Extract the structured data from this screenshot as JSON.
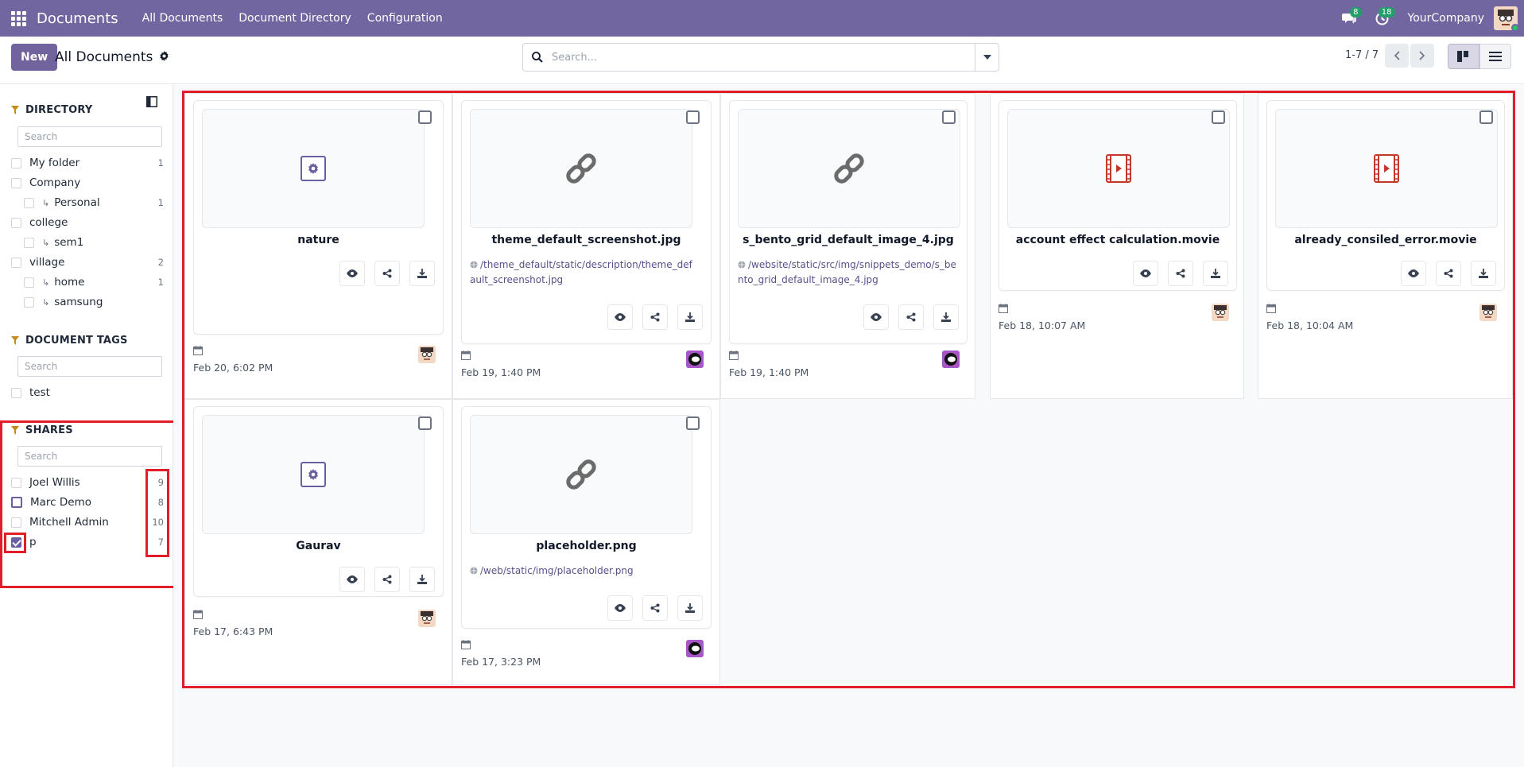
{
  "navbar": {
    "brand": "Documents",
    "menu": [
      "All Documents",
      "Document Directory",
      "Configuration"
    ],
    "messages_count": "8",
    "activities_count": "18",
    "company": "YourCompany"
  },
  "control": {
    "new_label": "New",
    "breadcrumb": "All Documents",
    "search_placeholder": "Search...",
    "pager": "1-7 / 7"
  },
  "sidebar": {
    "directory": {
      "title": "DIRECTORY",
      "search_placeholder": "Search",
      "items": [
        {
          "label": "My folder",
          "count": "1",
          "indent": false
        },
        {
          "label": "Company",
          "count": "",
          "indent": false
        },
        {
          "label": "Personal",
          "count": "1",
          "indent": true
        },
        {
          "label": "college",
          "count": "",
          "indent": false
        },
        {
          "label": "sem1",
          "count": "",
          "indent": true
        },
        {
          "label": "village",
          "count": "2",
          "indent": false
        },
        {
          "label": "home",
          "count": "1",
          "indent": true
        },
        {
          "label": "samsung",
          "count": "",
          "indent": true
        }
      ]
    },
    "tags": {
      "title": "DOCUMENT TAGS",
      "search_placeholder": "Search",
      "items": [
        {
          "label": "test",
          "count": ""
        }
      ]
    },
    "shares": {
      "title": "SHARES",
      "search_placeholder": "Search",
      "items": [
        {
          "label": "Joel Willis",
          "count": "9",
          "checked": false
        },
        {
          "label": "Marc Demo",
          "count": "8",
          "checked": false
        },
        {
          "label": "Mitchell Admin",
          "count": "10",
          "checked": false
        },
        {
          "label": "p",
          "count": "7",
          "checked": true
        }
      ]
    }
  },
  "cards": [
    {
      "name": "nature",
      "thumb": "gear-icon",
      "url": "",
      "date": "Feb 20, 6:02 PM",
      "avatar": "user-avatar"
    },
    {
      "name": "theme_default_screenshot.jpg",
      "thumb": "link-icon",
      "url": "/theme_default/static/description/theme_default_screenshot.jpg",
      "date": "Feb 19, 1:40 PM",
      "avatar": "bot-avatar"
    },
    {
      "name": "s_bento_grid_default_image_4.jpg",
      "thumb": "link-icon",
      "url": "/website/static/src/img/snippets_demo/s_bento_grid_default_image_4.jpg",
      "date": "Feb 19, 1:40 PM",
      "avatar": "bot-avatar"
    },
    {
      "name": "account effect calculation.movie",
      "thumb": "video-icon",
      "url": "",
      "date": "Feb 18, 10:07 AM",
      "avatar": "user-avatar"
    },
    {
      "name": "already_consiled_error.movie",
      "thumb": "video-icon",
      "url": "",
      "date": "Feb 18, 10:04 AM",
      "avatar": "user-avatar"
    },
    {
      "name": "Gaurav",
      "thumb": "gear-icon",
      "url": "",
      "date": "Feb 17, 6:43 PM",
      "avatar": "user-avatar"
    },
    {
      "name": "placeholder.png",
      "thumb": "link-icon",
      "url": "/web/static/img/placeholder.png",
      "date": "Feb 17, 3:23 PM",
      "avatar": "bot-avatar"
    }
  ],
  "colors": {
    "navbar": "#7166a0",
    "primary": "#71639e",
    "highlight": "#e11d2a",
    "link": "#5a4f8c"
  }
}
